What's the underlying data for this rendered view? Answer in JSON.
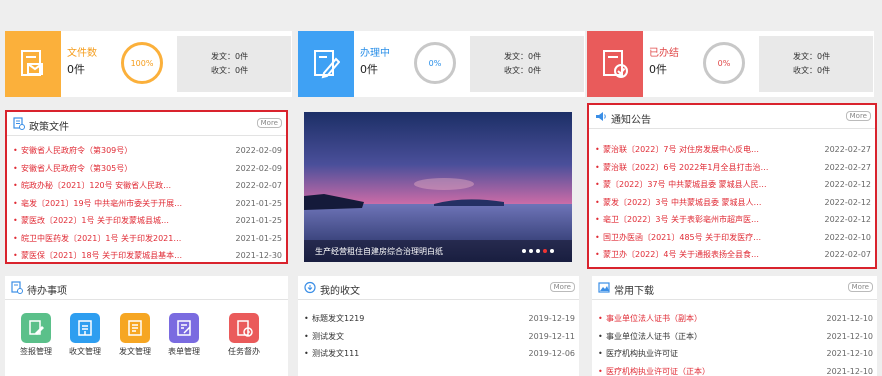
{
  "stats": [
    {
      "label": "文件数",
      "count": "0件",
      "percent": "100%",
      "sent": "发文：0件",
      "received": "收文：0件",
      "color": "#fbb03b",
      "ring": "#fbb03b",
      "label_color": "#f59c1a",
      "icon": "document-envelope-icon"
    },
    {
      "label": "办理中",
      "count": "0件",
      "percent": "0%",
      "sent": "发文：0件",
      "received": "收文：0件",
      "color": "#3fa1f4",
      "ring": "#c8c8c8",
      "label_color": "#2a8fe8",
      "icon": "document-pen-icon"
    },
    {
      "label": "已办结",
      "count": "0件",
      "percent": "0%",
      "sent": "发文：0件",
      "received": "收文：0件",
      "color": "#e95b5b",
      "ring": "#c8c8c8",
      "label_color": "#e04848",
      "icon": "document-check-icon"
    }
  ],
  "policy": {
    "title": "政策文件",
    "more": "More",
    "items": [
      {
        "title": "安徽省人民政府令（第309号）",
        "date": "2022-02-09"
      },
      {
        "title": "安徽省人民政府令（第305号）",
        "date": "2022-02-09"
      },
      {
        "title": "皖政办秘〔2021〕120号 安徽省人民政…",
        "date": "2022-02-07"
      },
      {
        "title": "亳发〔2021〕19号 中共亳州市委关于开展…",
        "date": "2021-01-25"
      },
      {
        "title": "蒙医改〔2022〕1号 关于印发蒙城县城…",
        "date": "2021-01-25"
      },
      {
        "title": "皖卫中医药发〔2021〕1号 关于印发2021…",
        "date": "2021-01-25"
      },
      {
        "title": "蒙医保〔2021〕18号 关于印发蒙城县基本…",
        "date": "2021-12-30"
      }
    ]
  },
  "banner": {
    "caption": "生产经营租住自建房综合治理明白纸"
  },
  "notice": {
    "title": "通知公告",
    "more": "More",
    "items": [
      {
        "title": "蒙治联〔2022〕7号 对住房发展中心反电…",
        "date": "2022-02-27"
      },
      {
        "title": "蒙治联〔2022〕6号 2022年1月全县打击治…",
        "date": "2022-02-27"
      },
      {
        "title": "蒙〔2022〕37号 中共蒙城县委 蒙城县人民…",
        "date": "2022-02-12"
      },
      {
        "title": "蒙发〔2022〕3号 中共蒙城县委 蒙城县人…",
        "date": "2022-02-12"
      },
      {
        "title": "亳卫〔2022〕3号 关于表彰亳州市超声医…",
        "date": "2022-02-12"
      },
      {
        "title": "国卫办医函〔2021〕485号 关于印发医疗…",
        "date": "2022-02-10"
      },
      {
        "title": "蒙卫办〔2022〕4号 关于通报表扬全县食…",
        "date": "2022-02-07"
      }
    ]
  },
  "todo": {
    "title": "待办事项",
    "items": [
      {
        "label": "签报管理",
        "color": "#5bc08a",
        "icon": "sign-edit-icon"
      },
      {
        "label": "收文管理",
        "color": "#2e9ef0",
        "icon": "inbox-doc-icon"
      },
      {
        "label": "发文管理",
        "color": "#f6a623",
        "icon": "send-doc-icon"
      },
      {
        "label": "表单管理",
        "color": "#7a6be0",
        "icon": "form-edit-icon"
      },
      {
        "label": "任务督办",
        "color": "#ea5b5b",
        "icon": "task-clock-icon"
      }
    ]
  },
  "received": {
    "title": "我的收文",
    "more": "More",
    "items": [
      {
        "title": "标题发文1219",
        "date": "2019-12-19"
      },
      {
        "title": "测试发文",
        "date": "2019-12-11"
      },
      {
        "title": "测试发文111",
        "date": "2019-12-06"
      }
    ]
  },
  "downloads": {
    "title": "常用下载",
    "more": "More",
    "items": [
      {
        "title": "事业单位法人证书（副本）",
        "date": "2021-12-10",
        "red": true
      },
      {
        "title": "事业单位法人证书（正本）",
        "date": "2021-12-10",
        "red": false
      },
      {
        "title": "医疗机构执业许可证",
        "date": "2021-12-10",
        "red": false
      },
      {
        "title": "医疗机构执业许可证（正本）",
        "date": "2021-12-10",
        "red": true
      }
    ]
  }
}
